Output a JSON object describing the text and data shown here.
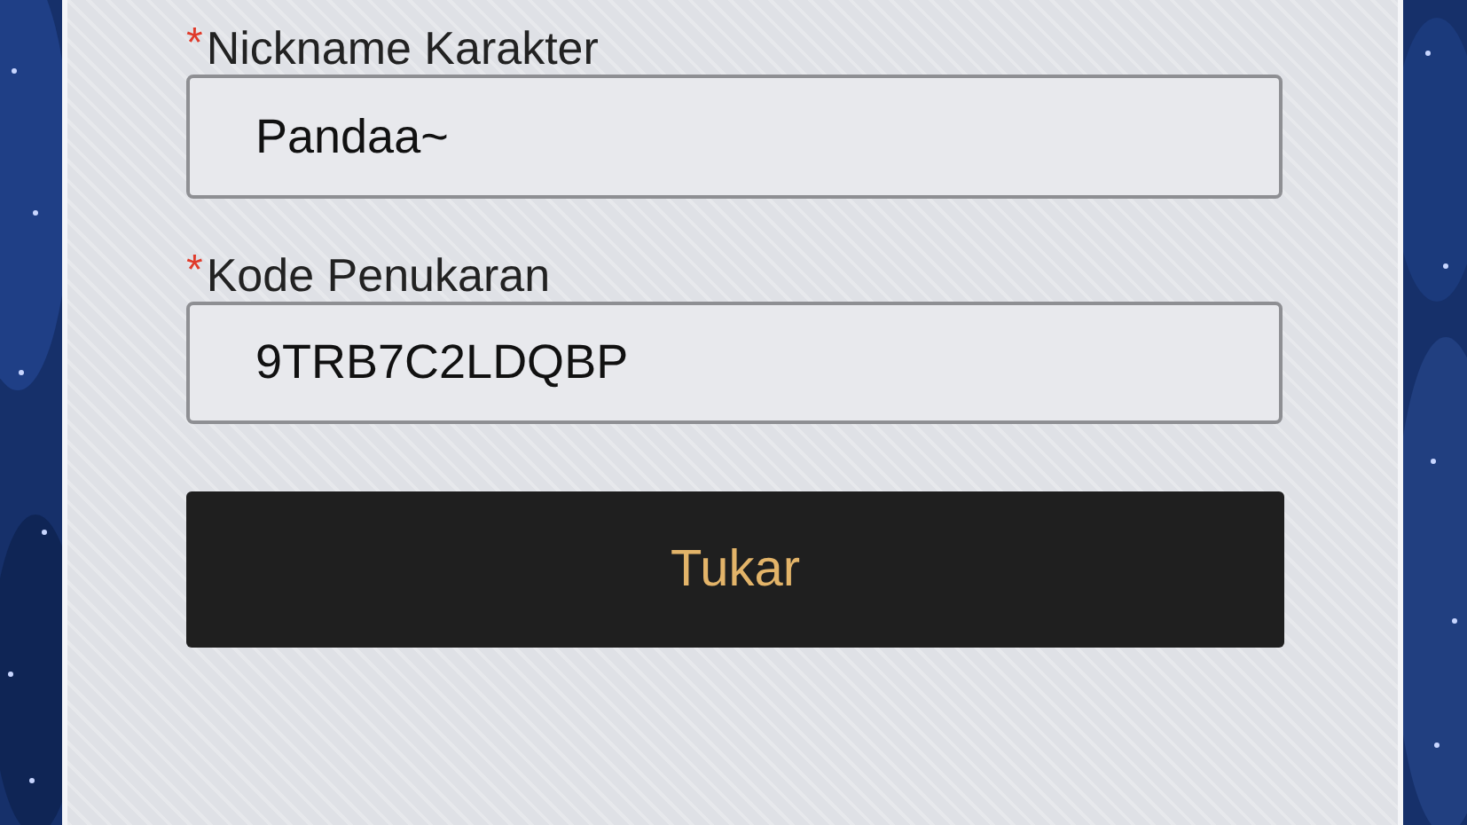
{
  "form": {
    "fields": [
      {
        "label": "Nickname Karakter",
        "required": true,
        "required_mark": "*",
        "value": "Pandaa~"
      },
      {
        "label": "Kode Penukaran",
        "required": true,
        "required_mark": "*",
        "value": "9TRB7C2LDQBP"
      }
    ],
    "submit_button": {
      "label": "Tukar"
    }
  }
}
